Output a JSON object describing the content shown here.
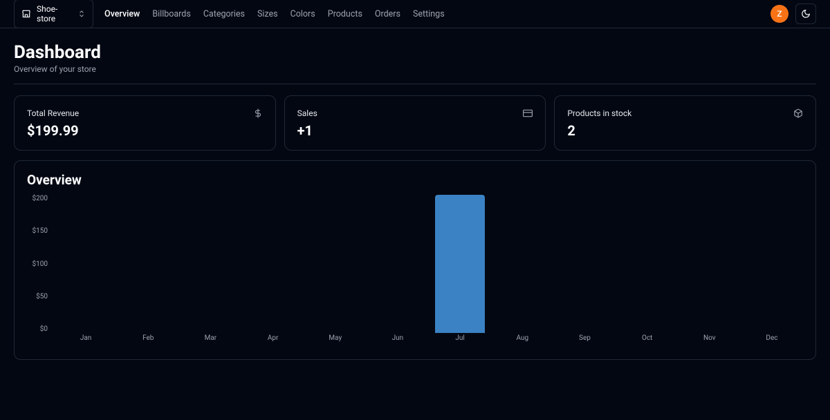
{
  "store": {
    "name": "Shoe-store"
  },
  "nav": {
    "items": [
      {
        "label": "Overview",
        "active": true
      },
      {
        "label": "Billboards",
        "active": false
      },
      {
        "label": "Categories",
        "active": false
      },
      {
        "label": "Sizes",
        "active": false
      },
      {
        "label": "Colors",
        "active": false
      },
      {
        "label": "Products",
        "active": false
      },
      {
        "label": "Orders",
        "active": false
      },
      {
        "label": "Settings",
        "active": false
      }
    ]
  },
  "avatar_initial": "Z",
  "page": {
    "title": "Dashboard",
    "subtitle": "Overview of your store"
  },
  "cards": {
    "revenue": {
      "label": "Total Revenue",
      "value": "$199.99"
    },
    "sales": {
      "label": "Sales",
      "value": "+1"
    },
    "stock": {
      "label": "Products in stock",
      "value": "2"
    }
  },
  "chart_title": "Overview",
  "chart_data": {
    "type": "bar",
    "categories": [
      "Jan",
      "Feb",
      "Mar",
      "Apr",
      "May",
      "Jun",
      "Jul",
      "Aug",
      "Sep",
      "Oct",
      "Nov",
      "Dec"
    ],
    "values": [
      0,
      0,
      0,
      0,
      0,
      0,
      199.99,
      0,
      0,
      0,
      0,
      0
    ],
    "y_ticks": [
      "$200",
      "$150",
      "$100",
      "$50",
      "$0"
    ],
    "ylim": [
      0,
      200
    ],
    "title": "Overview",
    "xlabel": "",
    "ylabel": ""
  }
}
